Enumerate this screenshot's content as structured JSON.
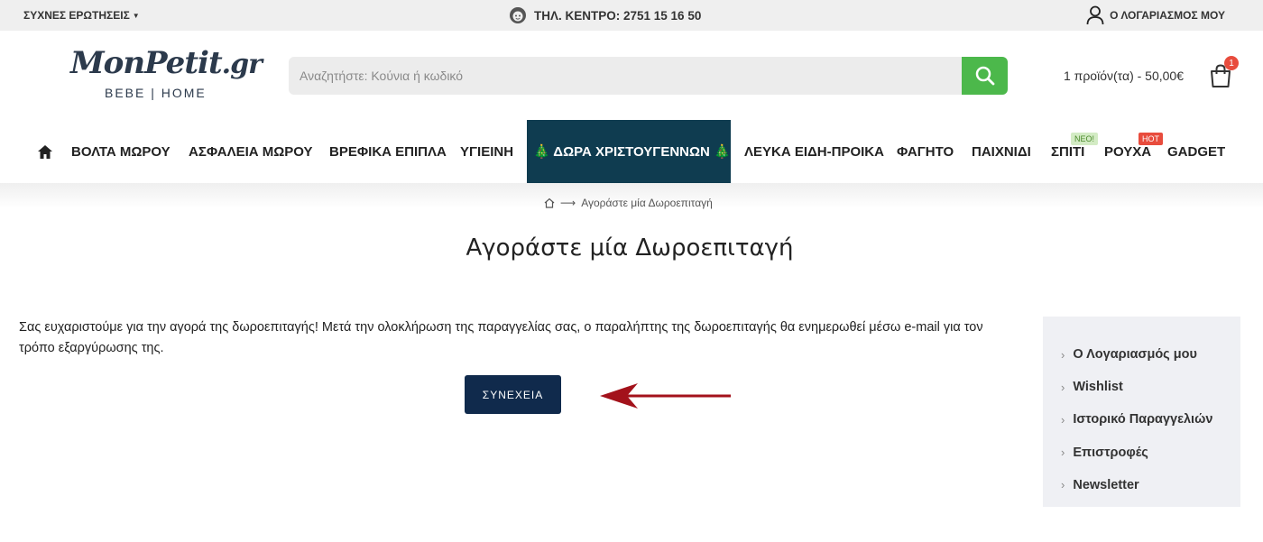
{
  "topbar": {
    "faq_label": "ΣΥΧΝΕΣ ΕΡΩΤΗΣΕΙΣ",
    "phone_label": "ΤΗΛ. ΚΕΝΤΡΟ: 2751 15 16 50",
    "account_label": "Ο ΛΟΓΑΡΙΑΣΜΟΣ ΜΟΥ"
  },
  "logo": {
    "main": "MonPetit",
    "domain": ".gr",
    "sub": "BEBE | HOME"
  },
  "search": {
    "placeholder": "Αναζητήστε: Κούνια ή κωδικό",
    "value": ""
  },
  "cart": {
    "summary": "1 προϊόν(τα) - 50,00€",
    "count": "1"
  },
  "nav": {
    "items": [
      "ΒΟΛΤΑ ΜΩΡΟΥ",
      "ΑΣΦΑΛΕΙΑ ΜΩΡΟΥ",
      "ΒΡΕΦΙΚΑ ΕΠΙΠΛΑ",
      "ΥΓΙΕΙΝΗ",
      "🎄 ΔΩΡΑ ΧΡΙΣΤΟΥΓΕΝΝΩΝ 🎄",
      "ΛΕΥΚΑ ΕΙΔΗ-ΠΡΟΙΚΑ",
      "ΦΑΓΗΤΟ",
      "ΠΑΙΧΝΙΔΙ",
      "ΣΠΙΤΙ",
      "ΡΟΥΧΑ",
      "GADGET"
    ],
    "tag_new": "ΝΕΟ!",
    "tag_hot": "HOT"
  },
  "breadcrumb": {
    "current": "Αγοράστε μία Δωροεπιταγή"
  },
  "page": {
    "title": "Αγοράστε μία Δωροεπιταγή",
    "message": "Σας ευχαριστούμε για την αγορά της δωροεπιταγής! Μετά την ολοκλήρωση της παραγγελίας σας, ο παραλήπτης της δωροεπιταγής θα ενημερωθεί μέσω e-mail για τον τρόπο εξαργύρωσης της.",
    "continue_label": "ΣΥΝΕΧΕΙΑ"
  },
  "sidebar": {
    "links": [
      "Ο Λογαριασμός μου",
      "Wishlist",
      "Ιστορικό Παραγγελιών",
      "Επιστροφές",
      "Newsletter"
    ]
  },
  "colors": {
    "search_button": "#4cb84b",
    "xmas_bg": "#0f3c50",
    "continue_bg": "#102a4c",
    "badge": "#e84c3d",
    "arrow": "#a3121b"
  }
}
